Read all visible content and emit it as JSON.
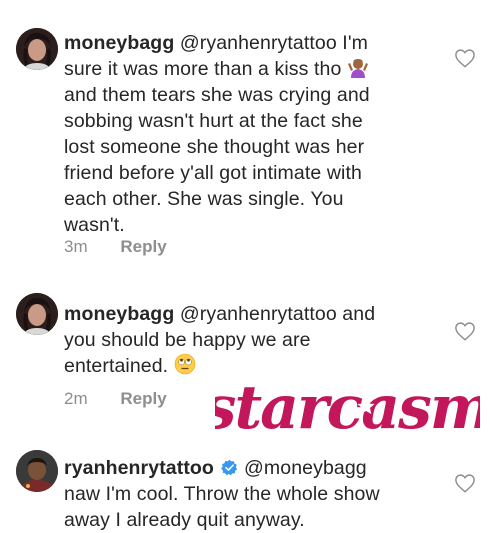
{
  "comments": [
    {
      "username": "moneybagg",
      "mention": "@ryanhenrytattoo",
      "line1_rest": " I'm",
      "line2": "sure it was more than a kiss tho",
      "line3": "and them tears she was crying and",
      "line4": "sobbing wasn't hurt at the fact she",
      "line5": "lost someone she thought was her",
      "line6": "friend before y'all got intimate with",
      "line7": "each other. She was single. You",
      "line8": "wasn't.",
      "time": "3m",
      "reply_label": "Reply",
      "emoji": "person-shrugging-emoji"
    },
    {
      "username": "moneybagg",
      "mention": "@ryanhenrytattoo",
      "line1_rest": " and",
      "line2": "you should be happy we are",
      "line3": "entertained.",
      "time": "2m",
      "reply_label": "Reply",
      "emoji": "face-with-rolling-eyes-emoji"
    },
    {
      "username": "ryanhenrytattoo",
      "mention": "@moneybagg",
      "line2": "naw I'm cool. Throw the whole show",
      "line3": "away I already quit anyway.",
      "verified": true
    }
  ],
  "watermark": {
    "text": "starcasm",
    "color": "#c2185b"
  },
  "colors": {
    "text": "#262626",
    "meta": "#8e8e8e",
    "verified": "#3897f0"
  }
}
